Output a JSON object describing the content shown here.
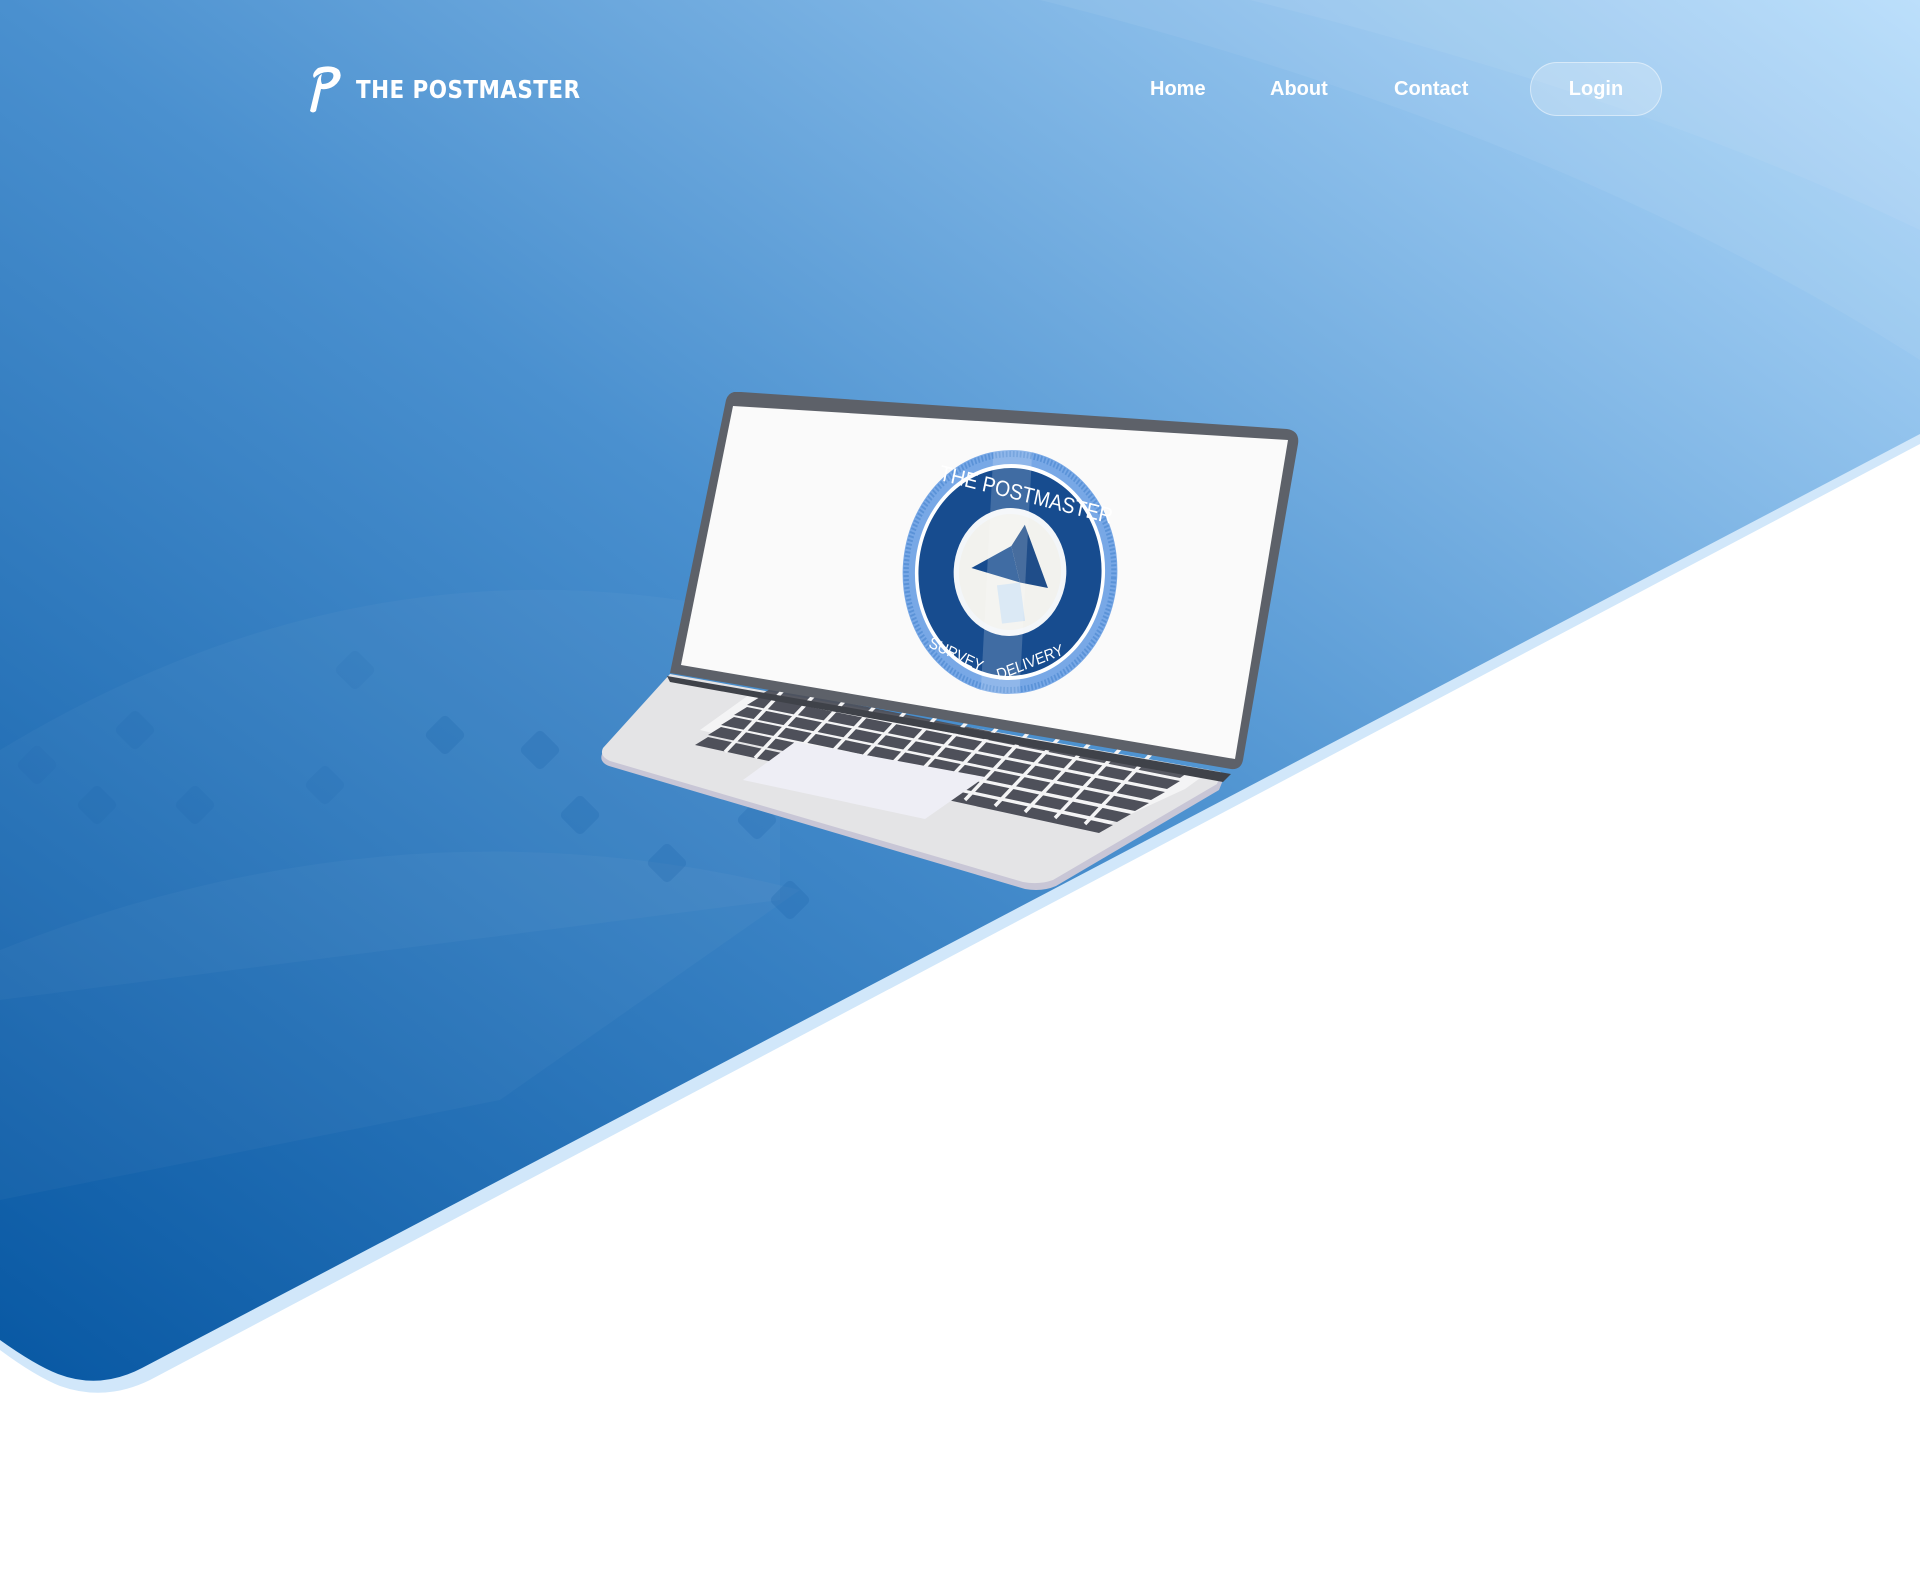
{
  "brand": {
    "mark": "P",
    "name": "THE POSTMASTER"
  },
  "nav": {
    "home": "Home",
    "about": "About",
    "contact": "Contact",
    "login": "Login"
  },
  "hero_illustration": {
    "subject": "laptop",
    "badge": {
      "top_text": "THE POSTMASTER",
      "bottom_left_text": "SURVEY",
      "bottom_right_text": "DELIVERY"
    }
  },
  "colors": {
    "gradient_dark": "#0858a3",
    "gradient_mid": "#4a90cf",
    "gradient_light": "#b4dbfb",
    "badge_navy": "#174c8f",
    "badge_ring": "#5b93d8",
    "laptop_bezel": "#5d6169",
    "laptop_body": "#e4e4e6",
    "white": "#ffffff"
  },
  "icons": {
    "brand_mark": "letter-p-logo-icon",
    "badge_symbol": "folded-paper-icon"
  }
}
